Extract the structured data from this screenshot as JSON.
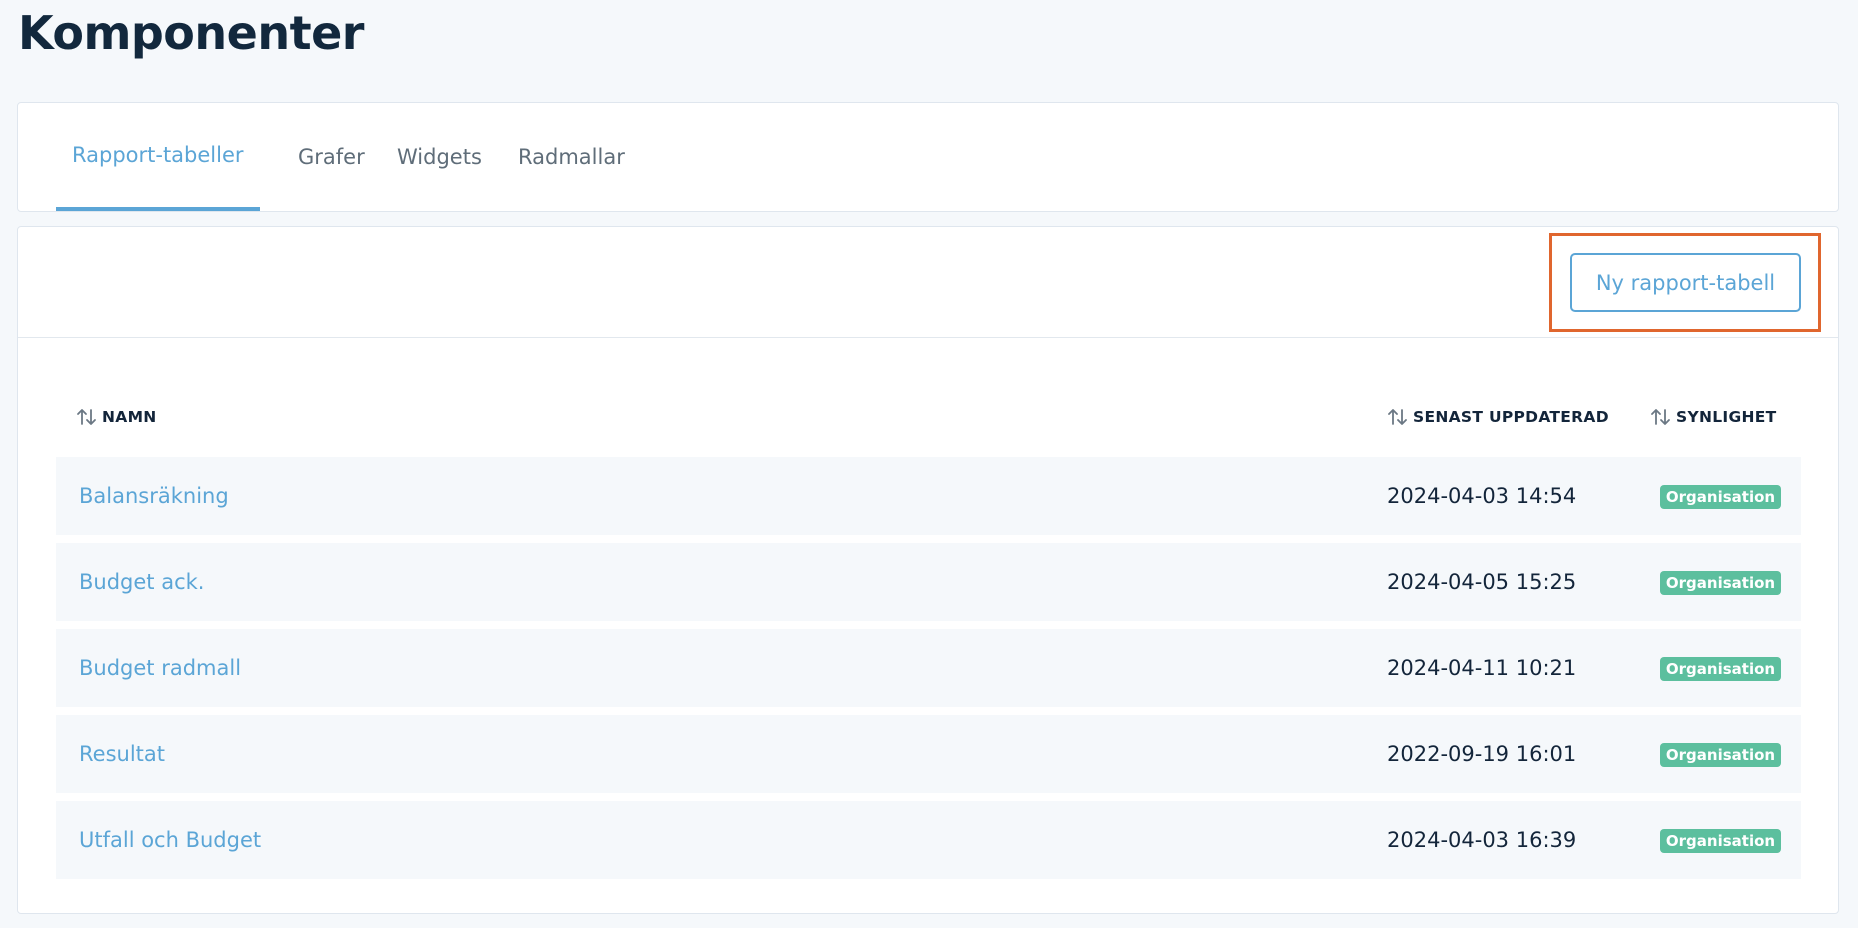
{
  "page": {
    "title": "Komponenter"
  },
  "tabs": [
    {
      "label": "Rapport-tabeller",
      "active": true
    },
    {
      "label": "Grafer",
      "active": false
    },
    {
      "label": "Widgets",
      "active": false
    },
    {
      "label": "Radmallar",
      "active": false
    }
  ],
  "toolbar": {
    "new_button_label": "Ny rapport-tabell"
  },
  "table": {
    "columns": {
      "name": "NAMN",
      "updated": "SENAST UPPDATERAD",
      "visibility": "SYNLIGHET"
    },
    "rows": [
      {
        "name": "Balansräkning",
        "updated": "2024-04-03 14:54",
        "visibility": "Organisation"
      },
      {
        "name": "Budget ack.",
        "updated": "2024-04-05 15:25",
        "visibility": "Organisation"
      },
      {
        "name": "Budget radmall",
        "updated": "2024-04-11 10:21",
        "visibility": "Organisation"
      },
      {
        "name": "Resultat",
        "updated": "2022-09-19 16:01",
        "visibility": "Organisation"
      },
      {
        "name": "Utfall och Budget",
        "updated": "2024-04-03 16:39",
        "visibility": "Organisation"
      }
    ]
  },
  "icons": {
    "sort": "sort-arrows-icon"
  },
  "colors": {
    "accent": "#5ba5d6",
    "badge": "#5cbf9e",
    "highlight": "#e0662e",
    "text": "#13253a",
    "background": "#f5f8fb"
  }
}
